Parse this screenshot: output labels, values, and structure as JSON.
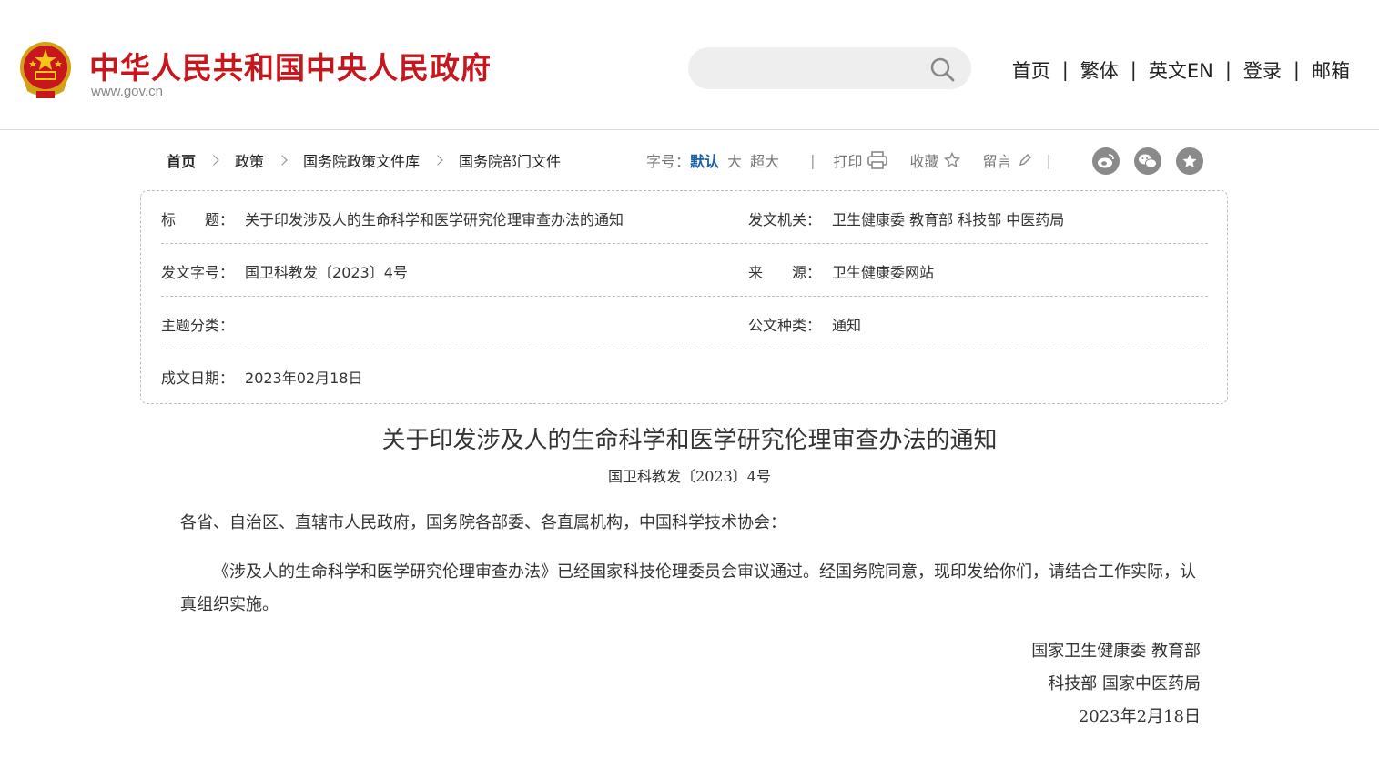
{
  "header": {
    "site_title": "中华人民共和国中央人民政府",
    "site_url": "www.gov.cn",
    "search_placeholder": "",
    "nav": [
      {
        "label": "首页"
      },
      {
        "label": "繁体"
      },
      {
        "label": "英文EN"
      },
      {
        "label": "登录"
      },
      {
        "label": "邮箱"
      }
    ],
    "nav_separator": "|"
  },
  "breadcrumb": [
    {
      "label": "首页"
    },
    {
      "label": "政策"
    },
    {
      "label": "国务院政策文件库"
    },
    {
      "label": "国务院部门文件"
    }
  ],
  "tools": {
    "font_size_label": "字号：",
    "font_default": "默认",
    "font_large": "大",
    "font_xlarge": "超大",
    "separator": "|",
    "print": "打印",
    "favorite": "收藏",
    "comment": "留言"
  },
  "meta": {
    "title_label": "标　　题：",
    "title_value": "关于印发涉及人的生命科学和医学研究伦理审查办法的通知",
    "issuer_label": "发文机关：",
    "issuer_value": "卫生健康委  教育部  科技部  中医药局",
    "doc_no_label": "发文字号：",
    "doc_no_value": "国卫科教发〔2023〕4号",
    "source_label": "来　　源：",
    "source_value": "卫生健康委网站",
    "topic_label": "主题分类：",
    "topic_value": "",
    "doc_type_label": "公文种类：",
    "doc_type_value": "通知",
    "date_label": "成文日期：",
    "date_value": "2023年02月18日"
  },
  "article": {
    "title": "关于印发涉及人的生命科学和医学研究伦理审查办法的通知",
    "doc_number": "国卫科教发〔2023〕4号",
    "salutation": "各省、自治区、直辖市人民政府，国务院各部委、各直属机构，中国科学技术协会：",
    "body": "《涉及人的生命科学和医学研究伦理审查办法》已经国家科技伦理委员会审议通过。经国务院同意，现印发给你们，请结合工作实际，认真组织实施。",
    "signature_line1": "国家卫生健康委  教育部",
    "signature_line2": "科技部  国家中医药局",
    "signature_date": "2023年2月18日"
  },
  "colors": {
    "brand_red": "#c8161d",
    "link_blue": "#1a5fa8",
    "share_gray": "#8a8a8a"
  },
  "icons": [
    "national-emblem",
    "search-icon",
    "printer-icon",
    "star-icon",
    "pencil-icon",
    "weibo-icon",
    "wechat-icon",
    "favorite-star-icon"
  ]
}
